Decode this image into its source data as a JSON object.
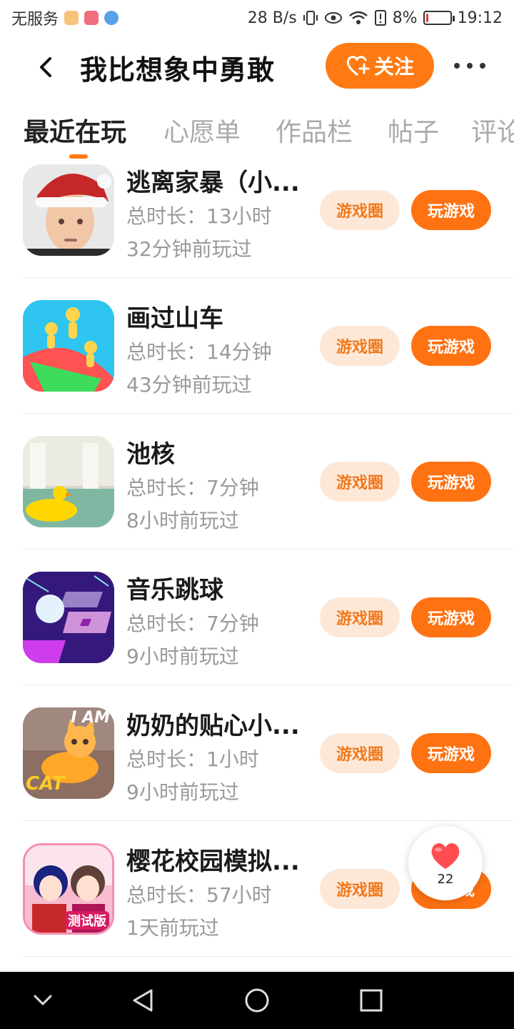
{
  "status_bar": {
    "carrier": "无服务",
    "speed": "28 B/s",
    "battery": "8%",
    "battery_level": 0.08,
    "time": "19:12"
  },
  "header": {
    "title": "我比想象中勇敢",
    "follow_label": "关注"
  },
  "tabs": [
    {
      "label": "最近在玩",
      "active": true
    },
    {
      "label": "心愿单",
      "active": false
    },
    {
      "label": "作品栏",
      "active": false
    },
    {
      "label": "帖子",
      "active": false
    },
    {
      "label": "评论",
      "active": false
    }
  ],
  "games": [
    {
      "name": "逃离家暴（小...",
      "duration": "总时长：13小时",
      "last_played": "32分钟前玩过",
      "circle_label": "游戏圈",
      "play_label": "玩游戏"
    },
    {
      "name": "画过山车",
      "duration": "总时长：14分钟",
      "last_played": "43分钟前玩过",
      "circle_label": "游戏圈",
      "play_label": "玩游戏"
    },
    {
      "name": "池核",
      "duration": "总时长：7分钟",
      "last_played": "8小时前玩过",
      "circle_label": "游戏圈",
      "play_label": "玩游戏"
    },
    {
      "name": "音乐跳球",
      "duration": "总时长：7分钟",
      "last_played": "9小时前玩过",
      "circle_label": "游戏圈",
      "play_label": "玩游戏"
    },
    {
      "name": "奶奶的贴心小...",
      "duration": "总时长：1小时",
      "last_played": "9小时前玩过",
      "circle_label": "游戏圈",
      "play_label": "玩游戏"
    },
    {
      "name": "樱花校园模拟...",
      "duration": "总时长：57小时",
      "last_played": "1天前玩过",
      "circle_label": "游戏圈",
      "play_label": "玩游戏"
    }
  ],
  "icon_text": {
    "cat_logo": "I AM CAT",
    "sakura_badge": "测试版"
  },
  "like": {
    "count": "22"
  },
  "colors": {
    "accent": "#ff7a12",
    "circle_bg": "#fde8d8",
    "circle_text": "#f0791e"
  }
}
